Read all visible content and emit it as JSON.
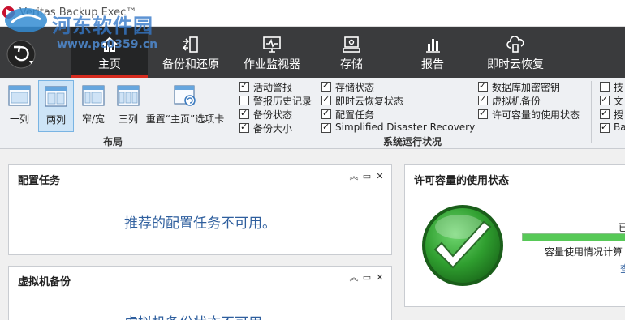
{
  "app": {
    "title": "Veritas Backup Exec™",
    "watermark_title": "河东软件园",
    "watermark_url": "www.pc0359.cn"
  },
  "nav": {
    "tabs": [
      {
        "label": "主页",
        "icon": "home-icon",
        "active": true
      },
      {
        "label": "备份和还原",
        "icon": "backup-restore-icon",
        "active": false
      },
      {
        "label": "作业监视器",
        "icon": "job-monitor-icon",
        "active": false
      },
      {
        "label": "存储",
        "icon": "storage-icon",
        "active": false
      },
      {
        "label": "报告",
        "icon": "reports-icon",
        "active": false
      },
      {
        "label": "即时云恢复",
        "icon": "cloud-recovery-icon",
        "active": false
      }
    ]
  },
  "ribbon": {
    "layout": {
      "group_label": "布局",
      "buttons": [
        "一列",
        "两列",
        "窄/宽",
        "三列",
        "重置“主页”选项卡"
      ],
      "selected": "两列"
    },
    "system_status": {
      "group_label": "系统运行状况",
      "col1": [
        {
          "label": "活动警报",
          "checked": true
        },
        {
          "label": "警报历史记录",
          "checked": false
        },
        {
          "label": "备份状态",
          "checked": true
        },
        {
          "label": "备份大小",
          "checked": true
        }
      ],
      "col2": [
        {
          "label": "存储状态",
          "checked": true
        },
        {
          "label": "即时云恢复状态",
          "checked": true
        },
        {
          "label": "配置任务",
          "checked": true
        },
        {
          "label": "Simplified Disaster Recovery",
          "checked": true
        }
      ],
      "col3": [
        {
          "label": "数据库加密密钥",
          "checked": true
        },
        {
          "label": "虚拟机备份",
          "checked": true
        },
        {
          "label": "许可容量的使用状态",
          "checked": true
        }
      ],
      "col4": [
        {
          "label": "技",
          "checked": false
        },
        {
          "label": "文",
          "checked": true
        },
        {
          "label": "授",
          "checked": true
        },
        {
          "label": "Ba",
          "checked": true
        }
      ]
    }
  },
  "panels": {
    "config_tasks": {
      "title": "配置任务",
      "message": "推荐的配置任务不可用。"
    },
    "vm_backup": {
      "title": "虚拟机备份",
      "message": "虚拟机备份状态不可用。"
    },
    "license_usage": {
      "title": "许可容量的使用状态",
      "label_top": "已",
      "label_mid": "容量使用情况计算",
      "label_bottom": "查",
      "usage_fraction": 1.0,
      "colors": {
        "ok": "#2f9e2f",
        "bar": "#57c957"
      }
    }
  },
  "colors": {
    "nav_bg": "#3a3b3d",
    "accent": "#d62b1f",
    "link_blue": "#2f5f9e"
  }
}
